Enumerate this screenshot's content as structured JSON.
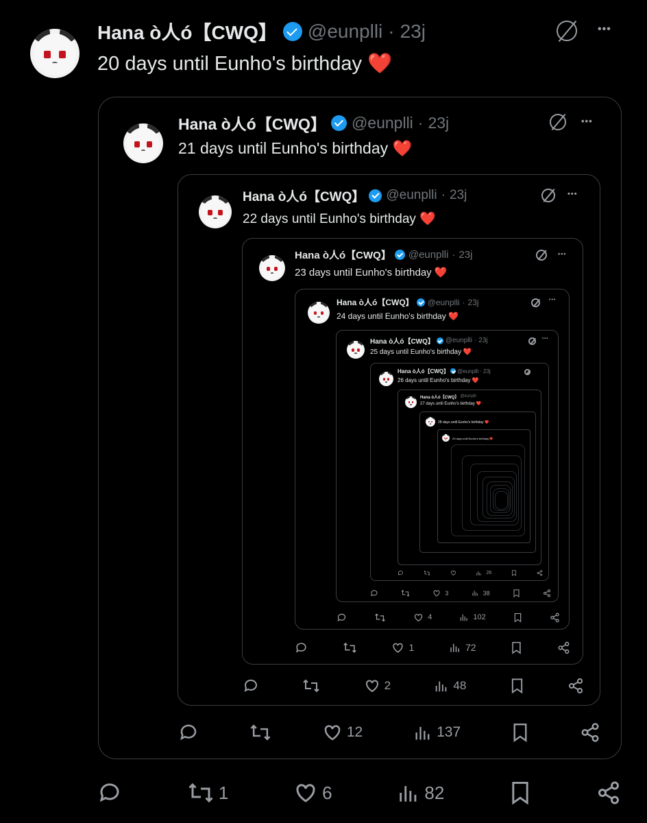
{
  "author": {
    "name": "Hana ò⼈ó【CWQ】",
    "handle": "@eunplli",
    "time": "23j"
  },
  "icons": {
    "reply": "reply-icon",
    "retweet": "retweet-icon",
    "like": "heart-icon",
    "views": "views-icon",
    "bookmark": "bookmark-icon",
    "share": "share-icon",
    "grok": "grok-icon",
    "more": "more-icon"
  },
  "more_label": "•••",
  "outer": {
    "text": "20 days until Eunho's birthday",
    "emoji": "❤️",
    "retweets": "1",
    "likes": "6",
    "views": "82"
  },
  "q1": {
    "text": "21 days until Eunho's birthday",
    "emoji": "❤️",
    "retweets": "",
    "likes": "12",
    "views": "137"
  },
  "q2": {
    "text": "22 days until Eunho's birthday",
    "emoji": "❤️",
    "retweets": "",
    "likes": "2",
    "views": "48"
  },
  "q3": {
    "text": "23 days until Eunho's birthday",
    "emoji": "❤️",
    "retweets": "",
    "likes": "1",
    "views": "72"
  },
  "q4": {
    "text": "24 days until Eunho's birthday",
    "emoji": "❤️",
    "retweets": "",
    "likes": "4",
    "views": "102"
  },
  "q5": {
    "text": "25 days until Eunho's birthday",
    "emoji": "❤️",
    "retweets": "",
    "likes": "3",
    "views": "38"
  },
  "q6": {
    "text": "26 days until Eunho's birthday",
    "emoji": "❤️",
    "retweets": "",
    "likes": "",
    "views": "26"
  },
  "q7": {
    "text": "27 days until Eunho's birthday",
    "emoji": "❤️"
  },
  "q8": {
    "text": "28 days until Eunho's birthday",
    "emoji": "❤️"
  },
  "q9": {
    "text": "29 days until Eunho's birthday",
    "emoji": "❤️"
  }
}
